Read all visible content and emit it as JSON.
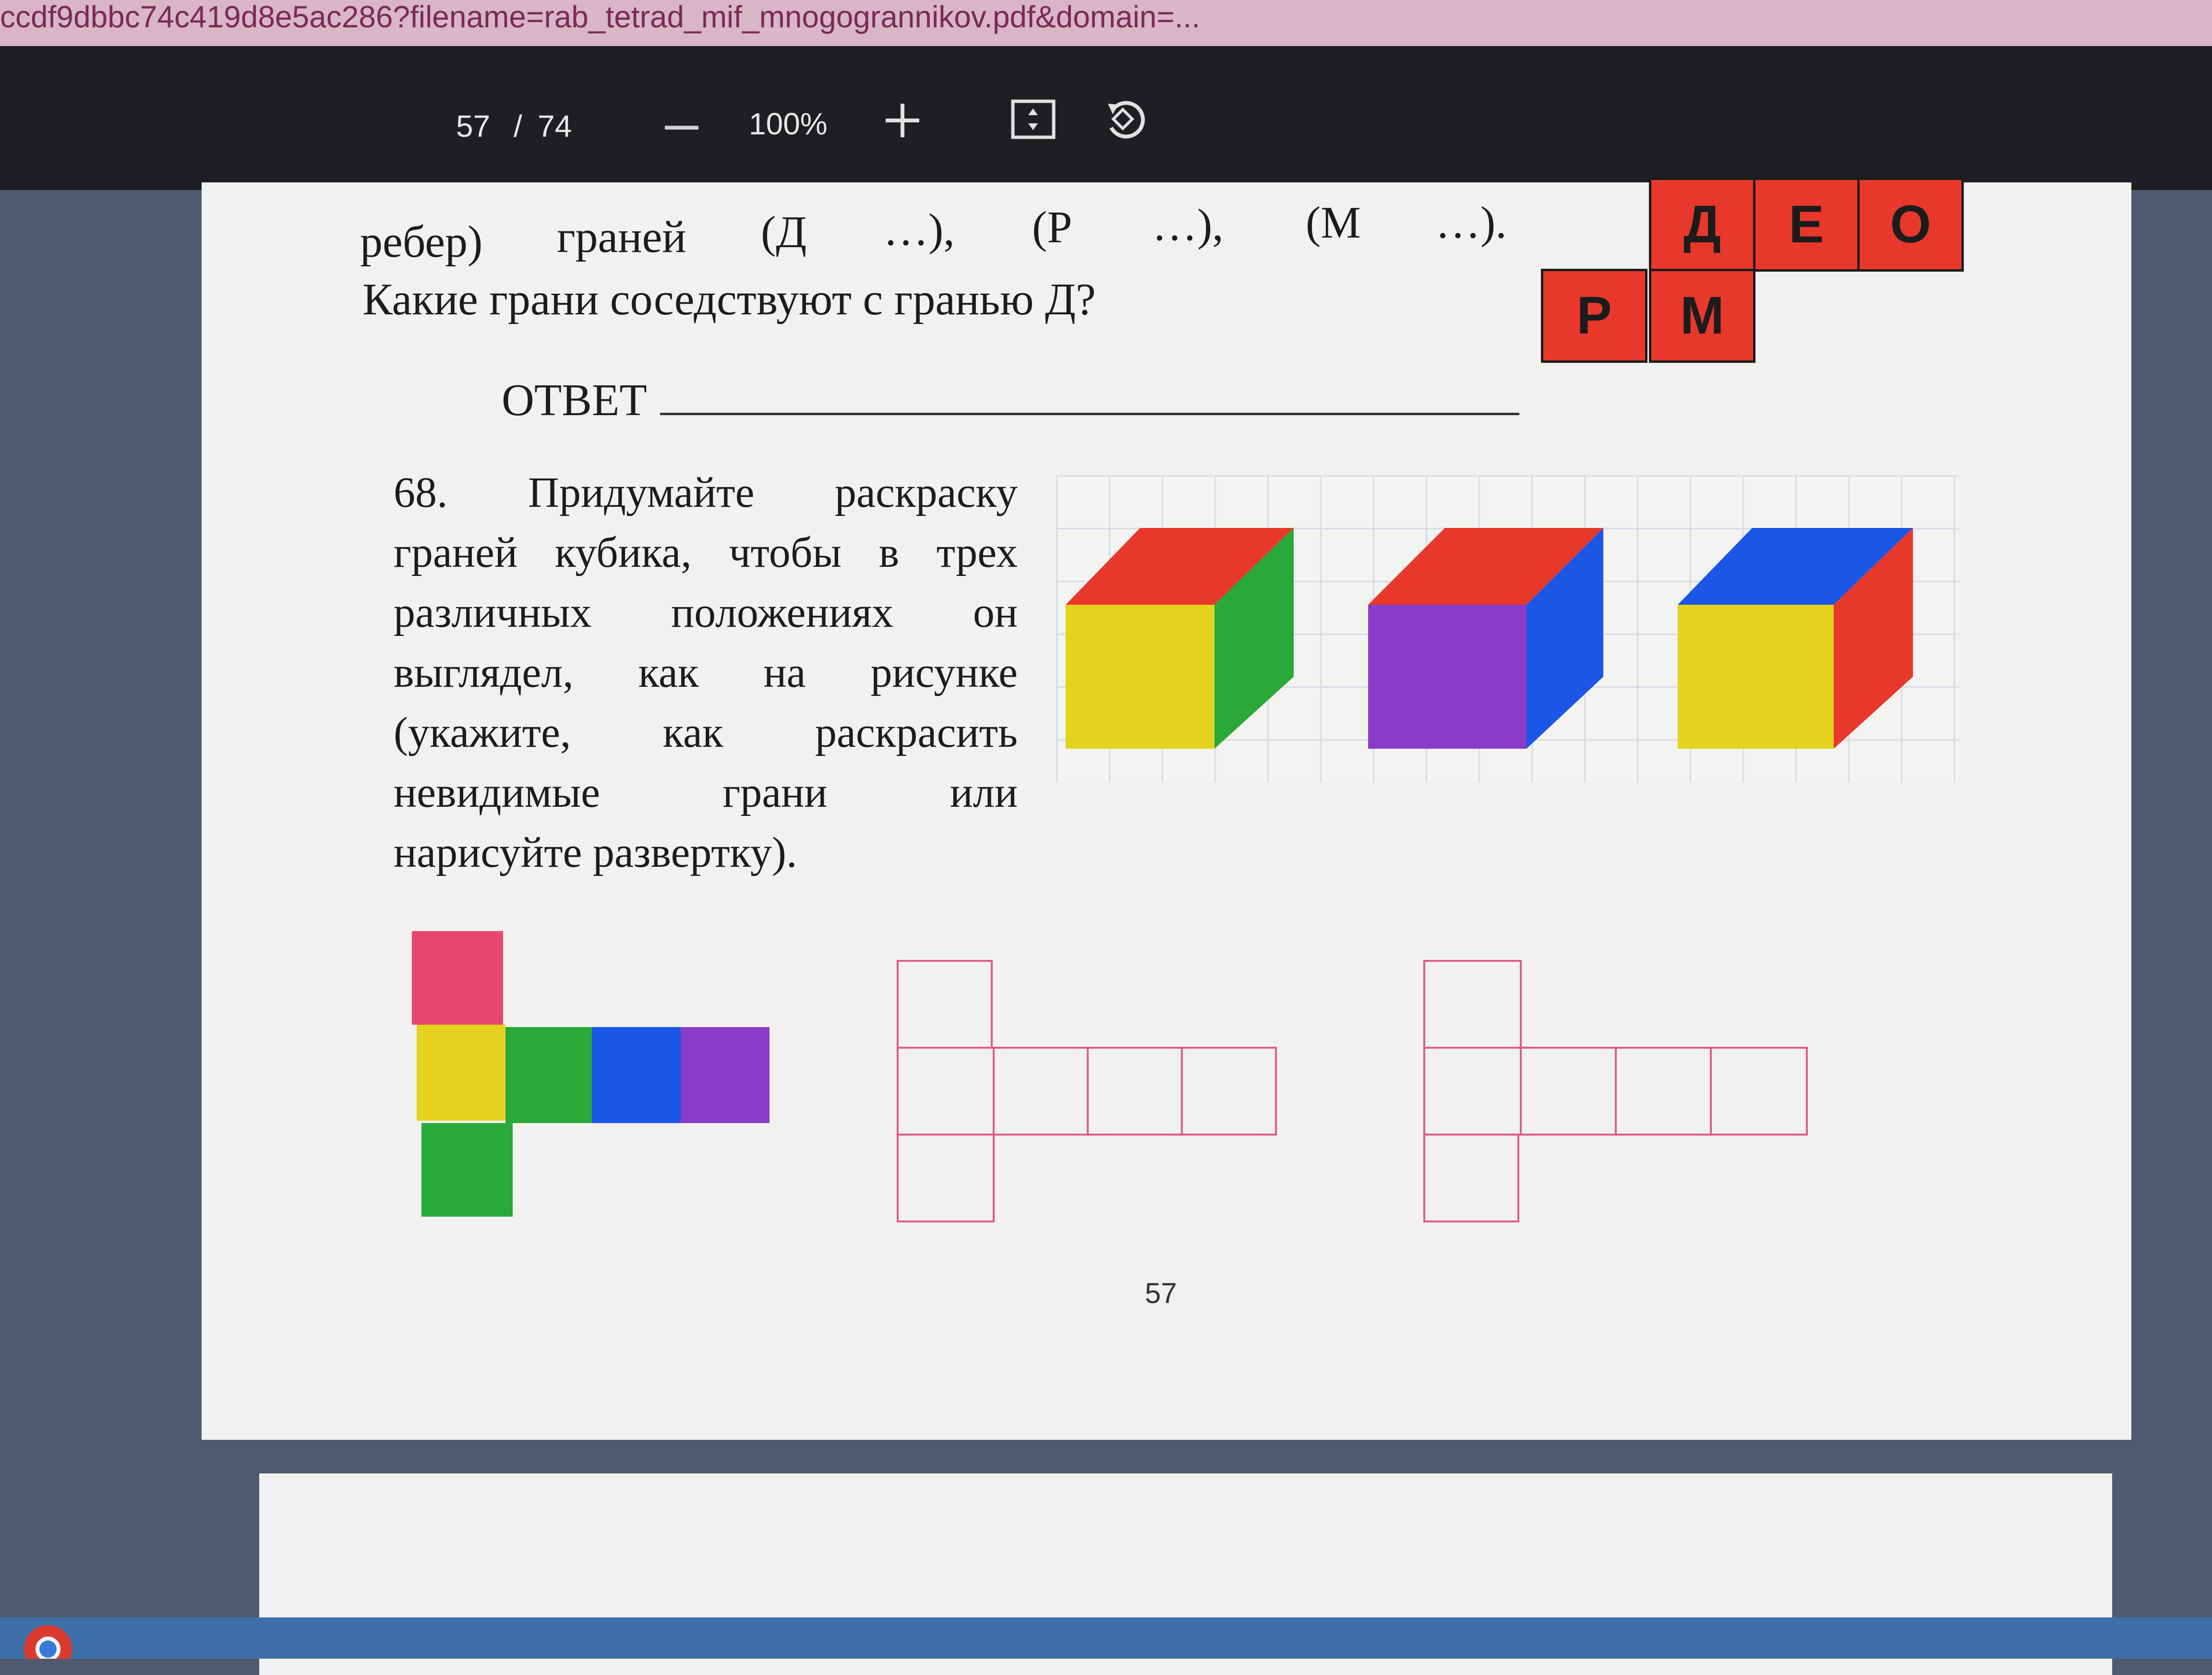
{
  "browser": {
    "url_fragment": "ccdf9dbbc74c419d8e5ac286?filename=rab_tetrad_mif_mnogogrannikov.pdf&domain=..."
  },
  "toolbar": {
    "current_page": "57",
    "page_separator": "/",
    "total_pages": "74",
    "zoom_level": "100%",
    "zoom_out_icon": "minus-icon",
    "zoom_in_icon": "plus-icon",
    "fit_icon": "fit-page-icon",
    "rotate_icon": "rotate-icon"
  },
  "page": {
    "top_line": {
      "w1": "ребер)",
      "w2": "граней",
      "w3": "(Д",
      "w4": "…),",
      "w5": "(Р",
      "w6": "…),",
      "w7": "(М",
      "w8": "…)."
    },
    "question": "Какие грани соседствуют с гранью Д?",
    "answer_label": "ОТВЕТ",
    "letter_net": {
      "top_row": [
        "Д",
        "Е",
        "О"
      ],
      "bottom_row": [
        "Р",
        "М"
      ]
    },
    "task68": {
      "lines": [
        "68.   Придумайте   раскраску",
        "граней  кубика,  чтобы  в  трех",
        "различных    положениях    он",
        "выглядел,   как   на   рисунке",
        "(укажите,    как    раскрасить",
        "невидимые      грани      или",
        "нарисуйте развертку)."
      ]
    },
    "page_number": "57"
  },
  "colors": {
    "red": "#e8382b",
    "green": "#2aa838",
    "yellow": "#e4d21e",
    "blue": "#1c56e6",
    "purple": "#8a3cc8",
    "pink": "#e8476c",
    "net_outline": "#e05a86"
  }
}
